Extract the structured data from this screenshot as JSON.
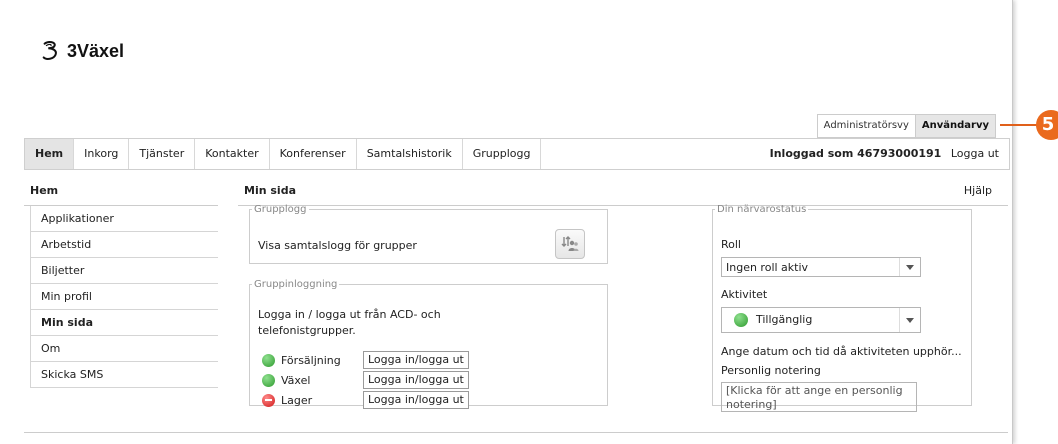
{
  "brand": {
    "name": "3Växel",
    "logo_icon": "three-logo-icon"
  },
  "view_toggle": {
    "admin": "Administratörsvy",
    "user": "Användarvy"
  },
  "nav": {
    "tabs": [
      "Hem",
      "Inkorg",
      "Tjänster",
      "Kontakter",
      "Konferenser",
      "Samtalshistorik",
      "Grupplogg"
    ],
    "active_tab": "Hem",
    "logged_in_as": "Inloggad som 46793000191",
    "logout": "Logga ut"
  },
  "sidebar": {
    "title": "Hem",
    "items": [
      {
        "label": "Applikationer"
      },
      {
        "label": "Arbetstid"
      },
      {
        "label": "Biljetter"
      },
      {
        "label": "Min profil"
      },
      {
        "label": "Min sida"
      },
      {
        "label": "Om"
      },
      {
        "label": "Skicka SMS"
      }
    ],
    "active_item": "Min sida"
  },
  "main": {
    "title": "Min sida",
    "help": "Hjälp",
    "grupplogg": {
      "legend": "Grupplogg",
      "text": "Visa samtalslogg för grupper",
      "icon": "group-call-log-icon"
    },
    "gruppinloggning": {
      "legend": "Gruppinloggning",
      "description": "Logga in / logga ut från ACD- och telefonistgrupper.",
      "groups": [
        {
          "name": "Försäljning",
          "status": "green",
          "button": "Logga in/logga ut"
        },
        {
          "name": "Växel",
          "status": "green",
          "button": "Logga in/logga ut"
        },
        {
          "name": "Lager",
          "status": "red",
          "button": "Logga in/logga ut"
        }
      ]
    },
    "presence": {
      "legend": "Din närvarostatus",
      "role_label": "Roll",
      "role_value": "Ingen roll aktiv",
      "activity_label": "Aktivitet",
      "activity_value": "Tillgänglig",
      "datetime_prompt": "Ange datum och tid då aktiviteten upphör...",
      "note_label": "Personlig notering",
      "note_placeholder": "[Klicka för att ange en personlig notering]"
    }
  },
  "callout": {
    "number": "5",
    "color": "#ea6a1e"
  },
  "colors": {
    "green": "#2e9a2e",
    "red": "#d01818",
    "active_tab_bg": "#e4e4e4"
  }
}
